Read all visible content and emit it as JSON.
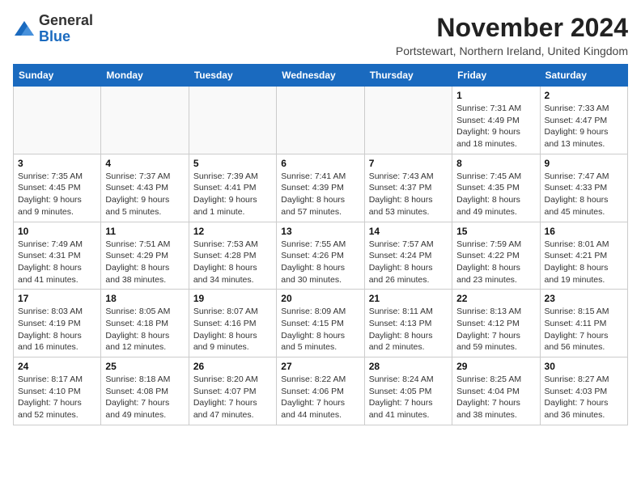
{
  "logo": {
    "general": "General",
    "blue": "Blue"
  },
  "header": {
    "month_year": "November 2024",
    "location": "Portstewart, Northern Ireland, United Kingdom"
  },
  "weekdays": [
    "Sunday",
    "Monday",
    "Tuesday",
    "Wednesday",
    "Thursday",
    "Friday",
    "Saturday"
  ],
  "weeks": [
    [
      {
        "day": "",
        "info": ""
      },
      {
        "day": "",
        "info": ""
      },
      {
        "day": "",
        "info": ""
      },
      {
        "day": "",
        "info": ""
      },
      {
        "day": "",
        "info": ""
      },
      {
        "day": "1",
        "info": "Sunrise: 7:31 AM\nSunset: 4:49 PM\nDaylight: 9 hours and 18 minutes."
      },
      {
        "day": "2",
        "info": "Sunrise: 7:33 AM\nSunset: 4:47 PM\nDaylight: 9 hours and 13 minutes."
      }
    ],
    [
      {
        "day": "3",
        "info": "Sunrise: 7:35 AM\nSunset: 4:45 PM\nDaylight: 9 hours and 9 minutes."
      },
      {
        "day": "4",
        "info": "Sunrise: 7:37 AM\nSunset: 4:43 PM\nDaylight: 9 hours and 5 minutes."
      },
      {
        "day": "5",
        "info": "Sunrise: 7:39 AM\nSunset: 4:41 PM\nDaylight: 9 hours and 1 minute."
      },
      {
        "day": "6",
        "info": "Sunrise: 7:41 AM\nSunset: 4:39 PM\nDaylight: 8 hours and 57 minutes."
      },
      {
        "day": "7",
        "info": "Sunrise: 7:43 AM\nSunset: 4:37 PM\nDaylight: 8 hours and 53 minutes."
      },
      {
        "day": "8",
        "info": "Sunrise: 7:45 AM\nSunset: 4:35 PM\nDaylight: 8 hours and 49 minutes."
      },
      {
        "day": "9",
        "info": "Sunrise: 7:47 AM\nSunset: 4:33 PM\nDaylight: 8 hours and 45 minutes."
      }
    ],
    [
      {
        "day": "10",
        "info": "Sunrise: 7:49 AM\nSunset: 4:31 PM\nDaylight: 8 hours and 41 minutes."
      },
      {
        "day": "11",
        "info": "Sunrise: 7:51 AM\nSunset: 4:29 PM\nDaylight: 8 hours and 38 minutes."
      },
      {
        "day": "12",
        "info": "Sunrise: 7:53 AM\nSunset: 4:28 PM\nDaylight: 8 hours and 34 minutes."
      },
      {
        "day": "13",
        "info": "Sunrise: 7:55 AM\nSunset: 4:26 PM\nDaylight: 8 hours and 30 minutes."
      },
      {
        "day": "14",
        "info": "Sunrise: 7:57 AM\nSunset: 4:24 PM\nDaylight: 8 hours and 26 minutes."
      },
      {
        "day": "15",
        "info": "Sunrise: 7:59 AM\nSunset: 4:22 PM\nDaylight: 8 hours and 23 minutes."
      },
      {
        "day": "16",
        "info": "Sunrise: 8:01 AM\nSunset: 4:21 PM\nDaylight: 8 hours and 19 minutes."
      }
    ],
    [
      {
        "day": "17",
        "info": "Sunrise: 8:03 AM\nSunset: 4:19 PM\nDaylight: 8 hours and 16 minutes."
      },
      {
        "day": "18",
        "info": "Sunrise: 8:05 AM\nSunset: 4:18 PM\nDaylight: 8 hours and 12 minutes."
      },
      {
        "day": "19",
        "info": "Sunrise: 8:07 AM\nSunset: 4:16 PM\nDaylight: 8 hours and 9 minutes."
      },
      {
        "day": "20",
        "info": "Sunrise: 8:09 AM\nSunset: 4:15 PM\nDaylight: 8 hours and 5 minutes."
      },
      {
        "day": "21",
        "info": "Sunrise: 8:11 AM\nSunset: 4:13 PM\nDaylight: 8 hours and 2 minutes."
      },
      {
        "day": "22",
        "info": "Sunrise: 8:13 AM\nSunset: 4:12 PM\nDaylight: 7 hours and 59 minutes."
      },
      {
        "day": "23",
        "info": "Sunrise: 8:15 AM\nSunset: 4:11 PM\nDaylight: 7 hours and 56 minutes."
      }
    ],
    [
      {
        "day": "24",
        "info": "Sunrise: 8:17 AM\nSunset: 4:10 PM\nDaylight: 7 hours and 52 minutes."
      },
      {
        "day": "25",
        "info": "Sunrise: 8:18 AM\nSunset: 4:08 PM\nDaylight: 7 hours and 49 minutes."
      },
      {
        "day": "26",
        "info": "Sunrise: 8:20 AM\nSunset: 4:07 PM\nDaylight: 7 hours and 47 minutes."
      },
      {
        "day": "27",
        "info": "Sunrise: 8:22 AM\nSunset: 4:06 PM\nDaylight: 7 hours and 44 minutes."
      },
      {
        "day": "28",
        "info": "Sunrise: 8:24 AM\nSunset: 4:05 PM\nDaylight: 7 hours and 41 minutes."
      },
      {
        "day": "29",
        "info": "Sunrise: 8:25 AM\nSunset: 4:04 PM\nDaylight: 7 hours and 38 minutes."
      },
      {
        "day": "30",
        "info": "Sunrise: 8:27 AM\nSunset: 4:03 PM\nDaylight: 7 hours and 36 minutes."
      }
    ]
  ]
}
